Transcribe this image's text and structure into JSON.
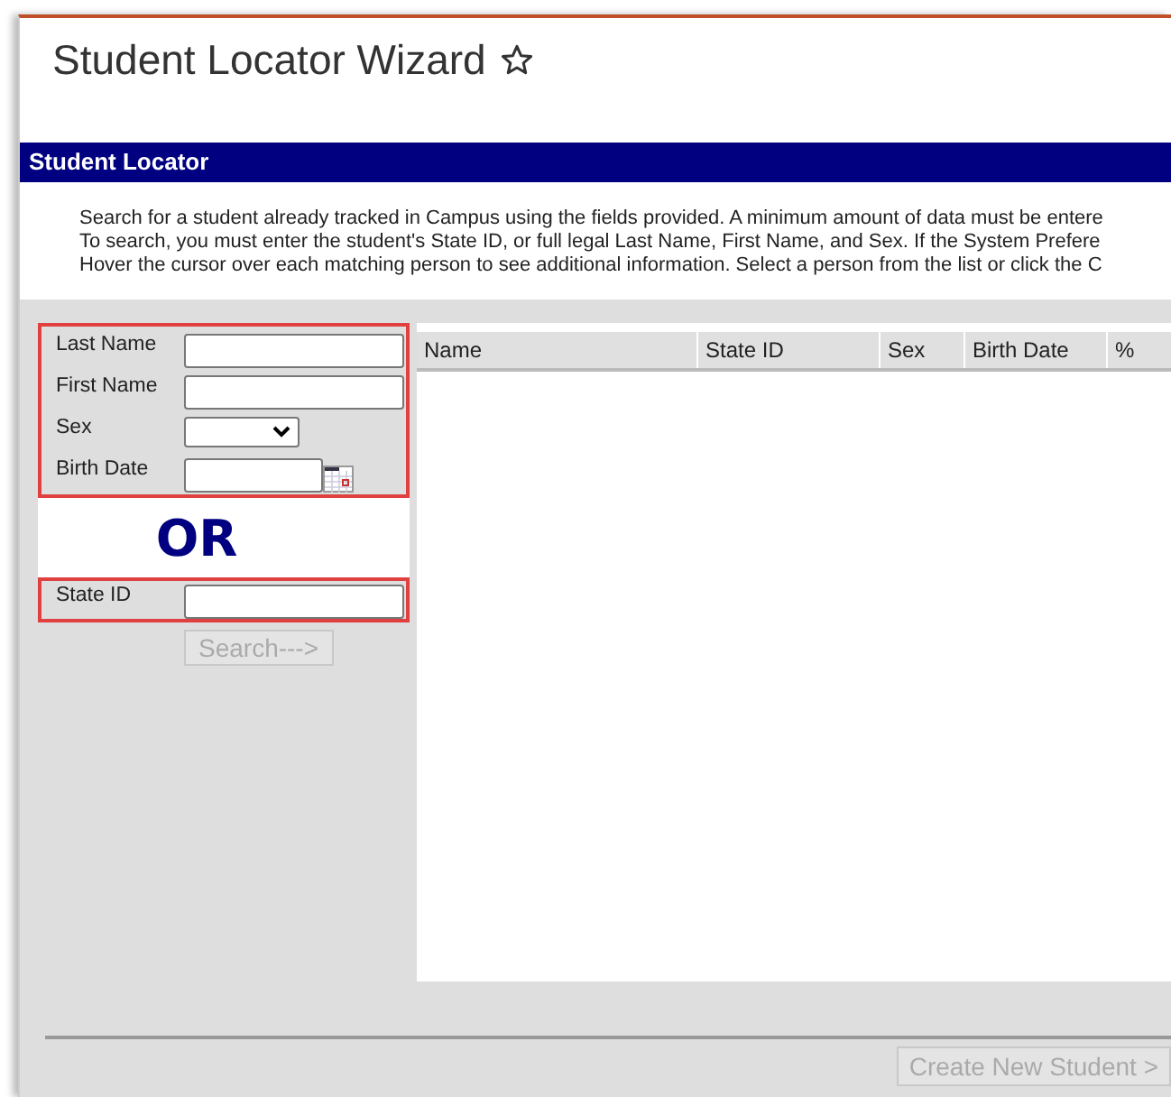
{
  "window": {
    "title": "Student Locator Wizard",
    "favorite": false
  },
  "section": {
    "title": "Student Locator"
  },
  "instructions": [
    "Search for a student already tracked in Campus using the fields provided. A minimum amount of data must be entere",
    "To search, you must enter the student's State ID, or full legal Last Name, First Name, and Sex. If the System Prefere",
    "Hover the cursor over each matching person to see additional information. Select a person from the list or click the C"
  ],
  "search_form": {
    "name_group": [
      {
        "label": "Last Name",
        "kind": "text"
      },
      {
        "label": "First Name",
        "kind": "text"
      },
      {
        "label": "Sex",
        "kind": "select"
      },
      {
        "label": "Birth Date",
        "kind": "date"
      }
    ],
    "separator": "OR",
    "id_group": [
      {
        "label": "State ID",
        "kind": "text"
      }
    ],
    "search_button": {
      "label": "Search--->",
      "disabled": true
    }
  },
  "results_table": {
    "columns": [
      "Name",
      "State ID",
      "Sex",
      "Birth Date",
      "%"
    ]
  },
  "footer": {
    "create_button": {
      "label": "Create New Student >",
      "disabled": true
    }
  }
}
